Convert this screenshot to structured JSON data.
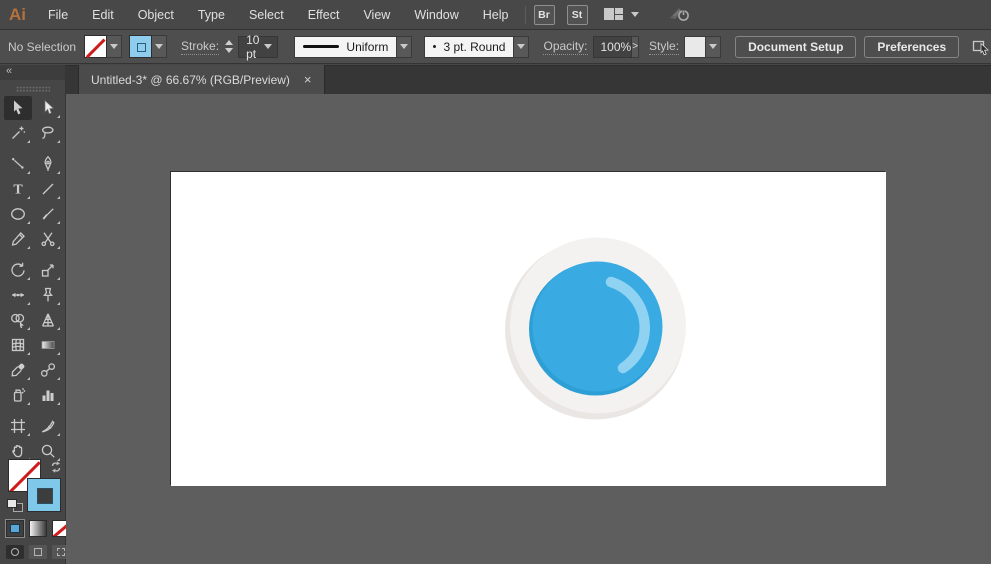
{
  "app": {
    "name": "Adobe Illustrator",
    "logo": "Ai"
  },
  "menubar": {
    "items": [
      "File",
      "Edit",
      "Object",
      "Type",
      "Select",
      "Effect",
      "View",
      "Window",
      "Help"
    ],
    "bridge_button": "Br",
    "stock_button": "St",
    "icons": [
      "workspace-switcher-icon",
      "chevron-down-icon",
      "gpu-performance-icon"
    ]
  },
  "controlbar": {
    "selection_status": "No Selection",
    "fill_swatch": "none",
    "stroke_swatch_color": "#8ECDED",
    "stroke_label": "Stroke:",
    "stroke_weight": "10 pt",
    "variable_width_profile": "Uniform",
    "brush_definition": "3 pt. Round",
    "opacity_label": "Opacity:",
    "opacity_value": "100%",
    "opacity_expander": ">",
    "style_label": "Style:",
    "document_setup_button": "Document Setup",
    "preferences_button": "Preferences",
    "icons": [
      "select-similar-icon",
      "chevron-down-icon"
    ]
  },
  "document_tab": {
    "title": "Untitled-3* @ 66.67% (RGB/Preview)",
    "close_glyph": "×"
  },
  "tools_panel": {
    "collapse_glyph": "«",
    "active_tool": "selection",
    "groups_rows": [
      2,
      4,
      6,
      2
    ],
    "tools": [
      {
        "name": "selection",
        "label": "Selection Tool"
      },
      {
        "name": "direct-selection",
        "label": "Direct Selection Tool"
      },
      {
        "name": "magic-wand",
        "label": "Magic Wand Tool"
      },
      {
        "name": "lasso",
        "label": "Lasso Tool"
      },
      {
        "name": "curvature",
        "label": "Curvature Tool"
      },
      {
        "name": "pen",
        "label": "Pen Tool"
      },
      {
        "name": "type",
        "label": "Type Tool"
      },
      {
        "name": "line-segment",
        "label": "Line Segment Tool"
      },
      {
        "name": "ellipse",
        "label": "Ellipse Tool"
      },
      {
        "name": "paintbrush",
        "label": "Paintbrush Tool"
      },
      {
        "name": "pencil",
        "label": "Pencil Tool"
      },
      {
        "name": "scissors",
        "label": "Scissors Tool"
      },
      {
        "name": "rotate",
        "label": "Rotate Tool"
      },
      {
        "name": "scale",
        "label": "Scale Tool"
      },
      {
        "name": "width",
        "label": "Width Tool"
      },
      {
        "name": "puppet-warp",
        "label": "Puppet Warp Tool"
      },
      {
        "name": "shape-builder",
        "label": "Shape Builder Tool"
      },
      {
        "name": "perspective-grid",
        "label": "Perspective Grid Tool"
      },
      {
        "name": "mesh",
        "label": "Mesh Tool"
      },
      {
        "name": "gradient",
        "label": "Gradient Tool"
      },
      {
        "name": "eyedropper",
        "label": "Eyedropper Tool"
      },
      {
        "name": "blend",
        "label": "Blend Tool"
      },
      {
        "name": "symbol-sprayer",
        "label": "Symbol Sprayer Tool"
      },
      {
        "name": "column-graph",
        "label": "Column Graph Tool"
      },
      {
        "name": "artboard",
        "label": "Artboard Tool"
      },
      {
        "name": "slice",
        "label": "Slice Tool"
      },
      {
        "name": "hand",
        "label": "Hand Tool"
      },
      {
        "name": "zoom",
        "label": "Zoom Tool"
      }
    ],
    "swatches": {
      "fill": "none",
      "stroke": "#7FC8EA",
      "buttons": [
        "color",
        "gradient",
        "none"
      ],
      "drawing_modes": [
        "draw-normal",
        "draw-behind",
        "draw-inside"
      ]
    }
  },
  "canvas": {
    "background": "#5E5E5E",
    "artboard_color": "#FFFFFF",
    "illustration": {
      "description": "flat blue circular button icon",
      "outer_ring_color": "#F3F2F0",
      "outer_ring_shadow": "#E9E6E3",
      "inner_circle_color": "#39ABE2",
      "inner_circle_shade": "#2D9FD5",
      "highlight_arc_color": "#8FD2F2"
    }
  },
  "colors": {
    "menubar_bg": "#484848",
    "controlbar_bg": "#4E4E4E",
    "panel_bg": "#464646",
    "tabbar_bg": "#363636",
    "canvas_bg": "#5E5E5E",
    "logo_orange": "#B5713C",
    "stroke_blue": "#8ECDED",
    "none_red": "#CF1B1B"
  }
}
